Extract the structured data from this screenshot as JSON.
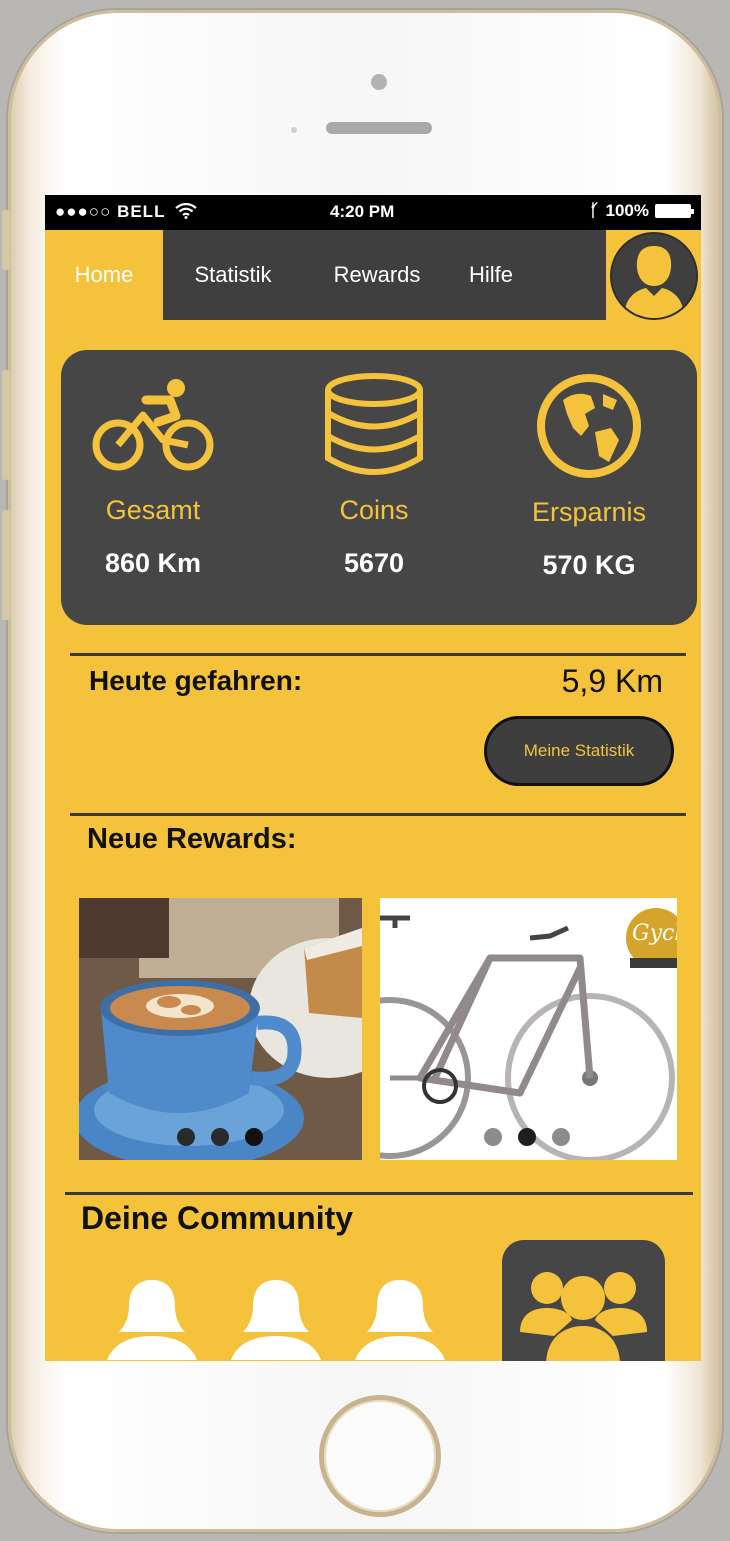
{
  "statusbar": {
    "carrier": "●●●○○ BELL",
    "time": "4:20 PM",
    "battery": "100%"
  },
  "nav": {
    "items": [
      {
        "label": "Home",
        "active": true
      },
      {
        "label": "Statistik"
      },
      {
        "label": "Rewards"
      },
      {
        "label": "Hilfe"
      }
    ],
    "avatar_icon": "user-avatar-icon"
  },
  "stats": [
    {
      "icon": "bicycle-icon",
      "label": "Gesamt",
      "value": "860 Km"
    },
    {
      "icon": "coins-stack-icon",
      "label": "Coins",
      "value": "5670"
    },
    {
      "icon": "globe-icon",
      "label": "Ersparnis",
      "value": "570 KG"
    }
  ],
  "today": {
    "label": "Heute gefahren:",
    "distance": "5,9 Km",
    "button": "Meine Statistik"
  },
  "rewards": {
    "heading": "Neue Rewards:",
    "items": [
      {
        "image": "coffee-cake-photo"
      },
      {
        "image": "city-bicycle-photo"
      }
    ]
  },
  "community": {
    "heading": "Deine Community",
    "icon": "group-icon"
  },
  "colors": {
    "accent": "#f4c33b",
    "dark": "#464646",
    "statusbar": "#000000"
  }
}
